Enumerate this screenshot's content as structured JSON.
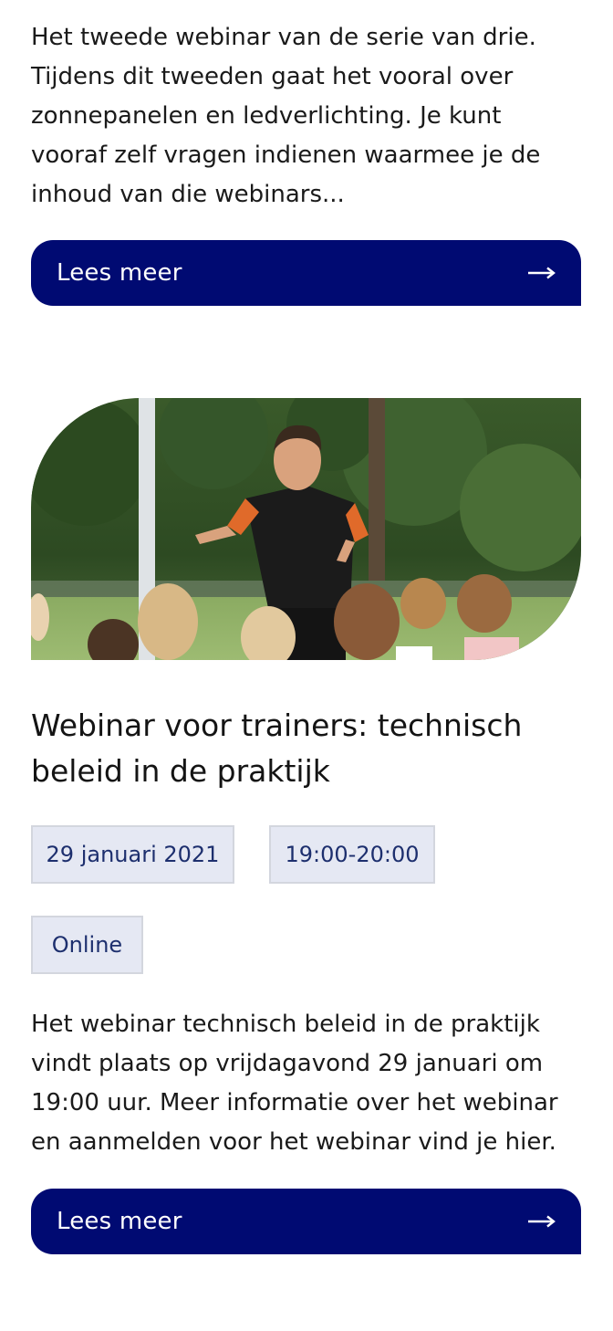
{
  "article_1": {
    "excerpt": "Het tweede webinar van de serie van drie. Tijdens dit tweeden gaat het vooral over zonnepanelen en ledverlichting. Je kunt vooraf zelf vragen indienen waarmee je de inhoud van die webinars...",
    "cta_label": "Lees meer",
    "cta_icon": "arrow-right-icon"
  },
  "article_2": {
    "image_subject": "trainer-speaking-to-children-photo",
    "title": "Webinar voor trainers: technisch beleid in de praktijk",
    "tags": {
      "date": "29 januari 2021",
      "time": "19:00-20:00",
      "location": "Online"
    },
    "excerpt": "Het webinar technisch beleid in de praktijk vindt plaats op vrijdagavond 29 januari om 19:00 uur. Meer informatie over het webinar en aanmelden voor het webinar vind je hier.",
    "cta_label": "Lees meer",
    "cta_icon": "arrow-right-icon"
  },
  "colors": {
    "brand_navy": "#000a72",
    "tag_background": "#e5e8f3",
    "tag_text": "#1d2f6e"
  }
}
